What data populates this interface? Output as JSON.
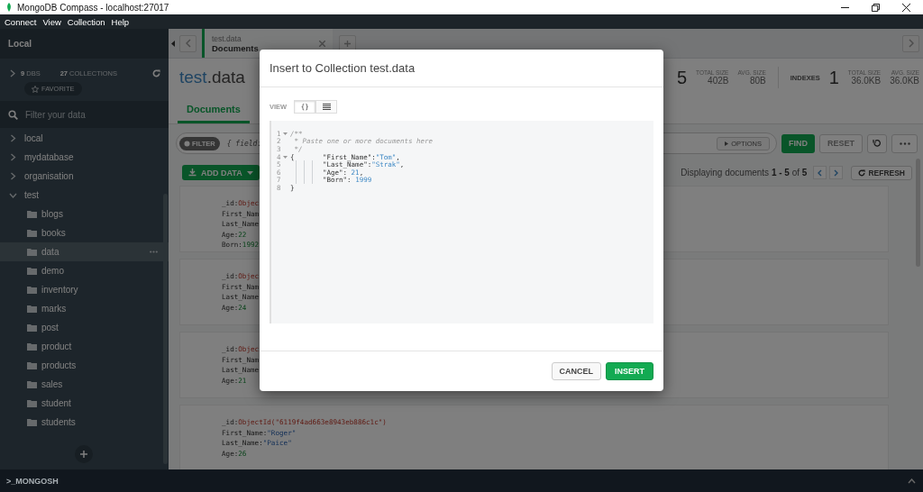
{
  "window": {
    "title": "MongoDB Compass - localhost:27017"
  },
  "menu": [
    "Connect",
    "View",
    "Collection",
    "Help"
  ],
  "sidebar": {
    "title": "Local",
    "dbs_count": "9",
    "dbs_label": "DBS",
    "collections_count": "27",
    "collections_label": "COLLECTIONS",
    "favorite": "FAVORITE",
    "filter_placeholder": "Filter your data",
    "tree": [
      {
        "label": "local",
        "expanded": false
      },
      {
        "label": "mydatabase",
        "expanded": false
      },
      {
        "label": "organisation",
        "expanded": false
      },
      {
        "label": "test",
        "expanded": true,
        "children": [
          {
            "label": "blogs",
            "selected": false
          },
          {
            "label": "books",
            "selected": false
          },
          {
            "label": "data",
            "selected": true
          },
          {
            "label": "demo",
            "selected": false
          },
          {
            "label": "inventory",
            "selected": false
          },
          {
            "label": "marks",
            "selected": false
          },
          {
            "label": "post",
            "selected": false
          },
          {
            "label": "product",
            "selected": false
          },
          {
            "label": "products",
            "selected": false
          },
          {
            "label": "sales",
            "selected": false
          },
          {
            "label": "student",
            "selected": false
          },
          {
            "label": "students",
            "selected": false
          }
        ]
      }
    ]
  },
  "tabs": [
    {
      "namespace": "test.data",
      "view": "Documents",
      "selected": true
    }
  ],
  "collection": {
    "db": "test",
    "name": ".data",
    "documents_count": "5",
    "document_sizes": [
      {
        "label": "TOTAL SIZE",
        "value": "402B"
      },
      {
        "label": "AVG. SIZE",
        "value": "80B"
      }
    ],
    "indexes_label": "INDEXES",
    "indexes_count": "1",
    "index_sizes": [
      {
        "label": "TOTAL SIZE",
        "value": "36.0KB"
      },
      {
        "label": "AVG. SIZE",
        "value": "36.0KB"
      }
    ]
  },
  "subtabs": [
    {
      "label": "Documents",
      "selected": true
    }
  ],
  "query": {
    "filter_label": "FILTER",
    "placeholder": "{ field:",
    "options": "OPTIONS",
    "find": "FIND",
    "reset": "RESET"
  },
  "toolbar": {
    "add_data": "ADD DATA",
    "displaying": "Displaying documents **1 - 5** of **5**",
    "refresh": "REFRESH"
  },
  "documents": [
    {
      "fields": [
        {
          "key": "_id:",
          "value": "Objec",
          "kind": "objectid"
        },
        {
          "key": "First_Nam"
        },
        {
          "key": "Last_Name"
        },
        {
          "key": "Age:",
          "value": "22",
          "kind": "number"
        },
        {
          "key": "Born:",
          "value": "1992",
          "kind": "number"
        }
      ]
    },
    {
      "fields": [
        {
          "key": "_id:",
          "value": "Objec",
          "kind": "objectid"
        },
        {
          "key": "First_Nam"
        },
        {
          "key": "Last_Name"
        },
        {
          "key": "Age:",
          "value": "24",
          "kind": "number"
        }
      ]
    },
    {
      "fields": [
        {
          "key": "_id:",
          "value": "Objec",
          "kind": "objectid"
        },
        {
          "key": "First_Nam"
        },
        {
          "key": "Last_Name"
        },
        {
          "key": "Age:",
          "value": "21",
          "kind": "number"
        }
      ]
    },
    {
      "fields": [
        {
          "key": "_id:",
          "value": "ObjectId(\"6119f4ad663e8943eb886c1c\")",
          "kind": "objectid"
        },
        {
          "key": "First_Name:",
          "value": "\"Roger\"",
          "kind": "string"
        },
        {
          "key": "Last_Name:",
          "value": "\"Paice\"",
          "kind": "string"
        },
        {
          "key": "Age:",
          "value": "26",
          "kind": "number"
        }
      ]
    }
  ],
  "modal": {
    "title": "Insert to Collection test.data",
    "view_label": "VIEW",
    "view_modes": [
      {
        "kind": "text",
        "label": "{}",
        "selected": true
      },
      {
        "kind": "list",
        "selected": false
      }
    ],
    "editor_lines": [
      {
        "number": "1",
        "fold": true,
        "tokens": [
          {
            "kind": "comment",
            "text": "/**"
          }
        ]
      },
      {
        "number": "2",
        "fold": false,
        "tokens": [
          {
            "kind": "comment",
            "text": " * Paste one or more documents here"
          }
        ]
      },
      {
        "number": "3",
        "fold": false,
        "tokens": [
          {
            "kind": "comment",
            "text": " */"
          }
        ]
      },
      {
        "number": "4",
        "fold": true,
        "lead": "{",
        "tokens": [
          {
            "kind": "key",
            "text": "\"First_Name\":"
          },
          {
            "kind": "string",
            "text": "\"Tom\""
          },
          {
            "kind": "punct",
            "text": ","
          }
        ]
      },
      {
        "number": "5",
        "fold": false,
        "guides": true,
        "tokens": [
          {
            "kind": "key",
            "text": "\"Last_Name\":"
          },
          {
            "kind": "string",
            "text": "\"Strak\""
          },
          {
            "kind": "punct",
            "text": ","
          }
        ]
      },
      {
        "number": "6",
        "fold": false,
        "guides": true,
        "tokens": [
          {
            "kind": "key",
            "text": "\"Age\": "
          },
          {
            "kind": "number",
            "text": "21"
          },
          {
            "kind": "punct",
            "text": ","
          }
        ]
      },
      {
        "number": "7",
        "fold": false,
        "guides": true,
        "tokens": [
          {
            "kind": "key",
            "text": "\"Born\": "
          },
          {
            "kind": "number",
            "text": "1999"
          }
        ]
      },
      {
        "number": "8",
        "fold": false,
        "tokens": [
          {
            "kind": "punct",
            "text": "}"
          }
        ]
      }
    ],
    "buttons": [
      {
        "label": "CANCEL",
        "kind": "secondary"
      },
      {
        "label": "INSERT",
        "kind": "primary"
      }
    ]
  },
  "footer": {
    "shell": ">_MONGOSH"
  }
}
